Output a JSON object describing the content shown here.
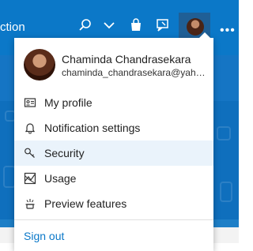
{
  "header": {
    "title_fragment": "ction",
    "icons": [
      "search-icon",
      "chevron-down-icon",
      "shopping-bag-icon",
      "feedback-icon",
      "more-icon"
    ],
    "more_label": "•••"
  },
  "profile": {
    "name": "Chaminda Chandrasekara",
    "email": "chaminda_chandrasekara@yahoo.com"
  },
  "menu": {
    "items": [
      {
        "label": "My profile",
        "icon": "id-card-icon"
      },
      {
        "label": "Notification settings",
        "icon": "bell-icon"
      },
      {
        "label": "Security",
        "icon": "key-icon",
        "highlighted": true
      },
      {
        "label": "Usage",
        "icon": "usage-chart-icon"
      },
      {
        "label": "Preview features",
        "icon": "preview-features-icon"
      }
    ],
    "sign_out": "Sign out"
  },
  "colors": {
    "header_bg": "#0b78c8",
    "link": "#0b78c8",
    "highlight_bg": "#eaf3fb"
  }
}
